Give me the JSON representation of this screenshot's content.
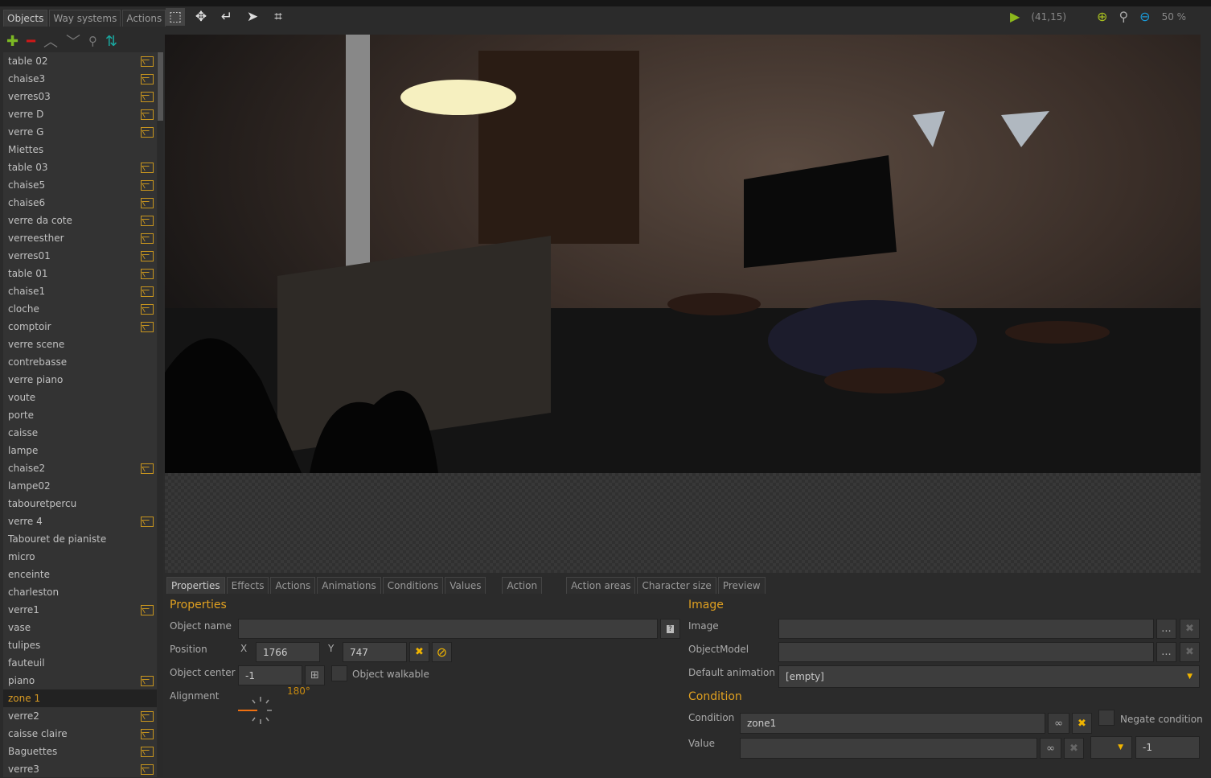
{
  "left_tabs": [
    "Objects",
    "Way systems",
    "Actions"
  ],
  "objects": [
    {
      "name": "table 02",
      "img": true
    },
    {
      "name": "chaise3",
      "img": true
    },
    {
      "name": "verres03",
      "img": true
    },
    {
      "name": "verre D",
      "img": true
    },
    {
      "name": "verre G",
      "img": true
    },
    {
      "name": "Miettes",
      "img": false
    },
    {
      "name": "table 03",
      "img": true
    },
    {
      "name": "chaise5",
      "img": true
    },
    {
      "name": "chaise6",
      "img": true
    },
    {
      "name": "verre da cote",
      "img": true
    },
    {
      "name": "verreesther",
      "img": true
    },
    {
      "name": "verres01",
      "img": true
    },
    {
      "name": "table 01",
      "img": true
    },
    {
      "name": "chaise1",
      "img": true
    },
    {
      "name": "cloche",
      "img": true
    },
    {
      "name": "comptoir",
      "img": true
    },
    {
      "name": "verre scene",
      "img": false
    },
    {
      "name": "contrebasse",
      "img": false
    },
    {
      "name": "verre piano",
      "img": false
    },
    {
      "name": "voute",
      "img": false
    },
    {
      "name": "porte",
      "img": false
    },
    {
      "name": "caisse",
      "img": false
    },
    {
      "name": "lampe",
      "img": false
    },
    {
      "name": "chaise2",
      "img": true
    },
    {
      "name": "lampe02",
      "img": false
    },
    {
      "name": "tabouretpercu",
      "img": false
    },
    {
      "name": "verre 4",
      "img": true
    },
    {
      "name": "Tabouret de pianiste",
      "img": false
    },
    {
      "name": "micro",
      "img": false
    },
    {
      "name": "enceinte",
      "img": false
    },
    {
      "name": "charleston",
      "img": false
    },
    {
      "name": "verre1",
      "img": true
    },
    {
      "name": "vase",
      "img": false
    },
    {
      "name": "tulipes",
      "img": false
    },
    {
      "name": "fauteuil",
      "img": false
    },
    {
      "name": "piano",
      "img": true
    },
    {
      "name": "zone 1",
      "img": false,
      "selected": true
    },
    {
      "name": "verre2",
      "img": true
    },
    {
      "name": "caisse claire",
      "img": true
    },
    {
      "name": "Baguettes",
      "img": true
    },
    {
      "name": "verre3",
      "img": true
    }
  ],
  "status": {
    "coords": "(41,15)",
    "zoom": "50 %"
  },
  "bottom_tabs": [
    "Properties",
    "Effects",
    "Actions",
    "Animations",
    "Conditions",
    "Values",
    "Action",
    "Action areas",
    "Character size",
    "Preview"
  ],
  "properties": {
    "title": "Properties",
    "object_name_label": "Object name",
    "object_name": "",
    "position_label": "Position",
    "x_label": "X",
    "x": "1766",
    "y_label": "Y",
    "y": "747",
    "center_label": "Object center",
    "center": "-1",
    "walkable_label": "Object walkable",
    "alignment_label": "Alignment",
    "angle": "180°"
  },
  "image": {
    "title": "Image",
    "image_label": "Image",
    "model_label": "ObjectModel",
    "anim_label": "Default animation",
    "anim_value": "[empty]",
    "more": "..."
  },
  "condition": {
    "title": "Condition",
    "condition_label": "Condition",
    "condition_value": "zone1",
    "negate_label": "Negate condition",
    "value_label": "Value",
    "value": "",
    "num": "-1"
  }
}
